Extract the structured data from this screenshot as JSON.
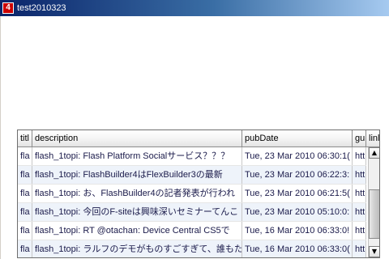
{
  "window": {
    "title": "test2010323",
    "icon_glyph": "4",
    "icon_color": "#cc0000"
  },
  "grid": {
    "columns": [
      "title",
      "description",
      "pubDate",
      "guid",
      "link"
    ],
    "column_headers_shown": [
      "titl",
      "description",
      "pubDate",
      "gu",
      "linl"
    ],
    "rows": [
      {
        "title": "fla",
        "description": "flash_1topi: Flash Platform Socialサービス？？？",
        "pubDate": "Tue, 23 Mar 2010 06:30:1(",
        "guid": "htt",
        "link": "http"
      },
      {
        "title": "fla",
        "description": "flash_1topi: FlashBuilder4はFlexBuilder3の最新",
        "pubDate": "Tue, 23 Mar 2010 06:22:3:",
        "guid": "htt",
        "link": "http"
      },
      {
        "title": "fla",
        "description": "flash_1topi: お、FlashBuilder4の記者発表が行われ",
        "pubDate": "Tue, 23 Mar 2010 06:21:5(",
        "guid": "htt",
        "link": "http"
      },
      {
        "title": "fla",
        "description": "flash_1topi: 今回のF-siteは興味深いセミナーてんこ",
        "pubDate": "Tue, 23 Mar 2010 05:10:0:",
        "guid": "htt",
        "link": "http"
      },
      {
        "title": "fla",
        "description": "flash_1topi: RT @otachan: Device Central CS5で",
        "pubDate": "Tue, 16 Mar 2010 06:33:0!",
        "guid": "htt",
        "link": "http"
      },
      {
        "title": "fla",
        "description": "flash_1topi: ラルフのデモがものすごすぎて、誰もた",
        "pubDate": "Tue, 16 Mar 2010 06:33:0(",
        "guid": "htt",
        "link": "http"
      }
    ],
    "scroll_position_fraction": 0.0,
    "scroll_visible_fraction": 0.6
  },
  "scrollbar": {
    "up_glyph": "▲",
    "down_glyph": "▼"
  }
}
